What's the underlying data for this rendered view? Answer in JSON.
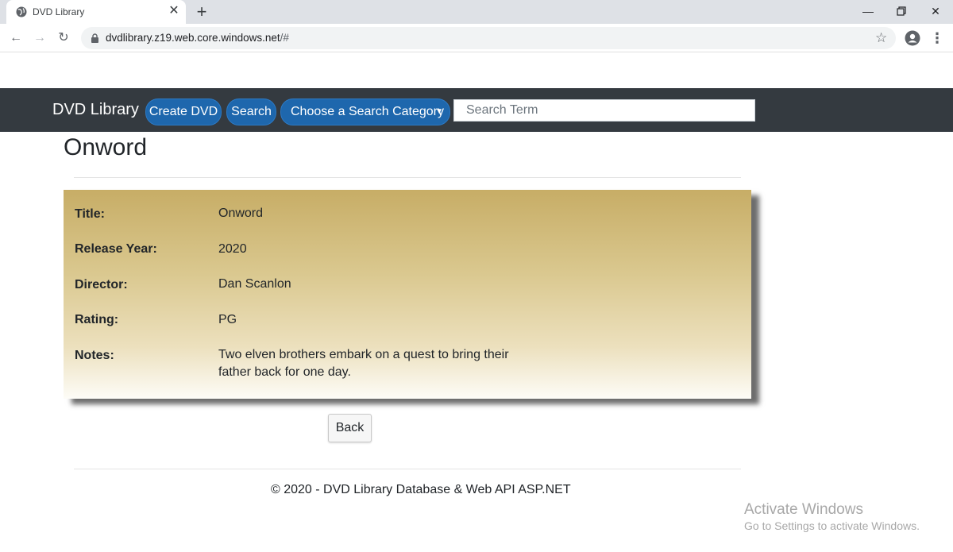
{
  "browser": {
    "tab_title": "DVD Library",
    "tab_close": "✕",
    "new_tab": "+",
    "url_host": "dvdlibrary.z19.web.core.windows.net",
    "url_path": "/#",
    "icons": [
      "globe-icon",
      "close-icon",
      "plus-icon",
      "back-arrow-icon",
      "forward-arrow-icon",
      "reload-icon",
      "lock-icon",
      "star-icon",
      "profile-icon",
      "kebab-menu-icon",
      "minimize-icon",
      "restore-icon",
      "close-window-icon"
    ]
  },
  "navbar": {
    "brand": "DVD Library",
    "create_label": "Create DVD",
    "search_label": "Search",
    "category_label": "Choose a Search Category",
    "search_placeholder": "Search Term",
    "background_color": "#343a40",
    "pill_color": "#1e67ad"
  },
  "dvd": {
    "heading": "Onword",
    "fields": [
      {
        "label": "Title:",
        "value": "Onword"
      },
      {
        "label": "Release Year:",
        "value": "2020"
      },
      {
        "label": "Director:",
        "value": "Dan Scanlon"
      },
      {
        "label": "Rating:",
        "value": "PG"
      },
      {
        "label": "Notes:",
        "value": "Two elven brothers embark on a quest to bring their father back for one day."
      }
    ]
  },
  "actions": {
    "back_label": "Back"
  },
  "footer": {
    "text": "© 2020 - DVD Library Database & Web API ASP.NET"
  },
  "watermark": {
    "title": "Activate Windows",
    "subtitle": "Go to Settings to activate Windows."
  }
}
